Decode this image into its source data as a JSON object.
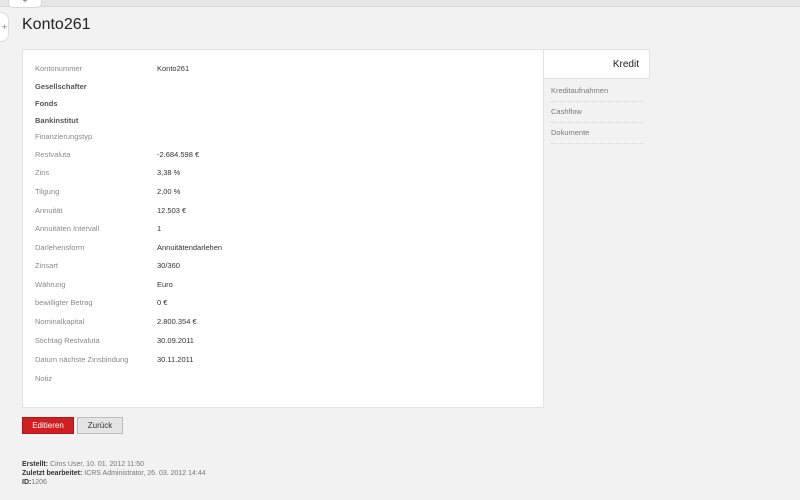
{
  "header": {
    "title": "Konto261",
    "top_tab_icon": "+",
    "side_toggle_icon": "+"
  },
  "details": [
    {
      "label": "Kontonummer",
      "value": "Konto261",
      "bold": false
    },
    {
      "label": "Gesellschafter",
      "value": "",
      "bold": true
    },
    {
      "label": "Fonds",
      "value": "",
      "bold": true
    },
    {
      "label": "Bankinstitut",
      "value": "",
      "bold": true
    },
    {
      "label": "Finanzierungstyp",
      "value": "",
      "bold": false
    },
    {
      "label": "Restvaluta",
      "value": "-2.684.598 €",
      "bold": false
    },
    {
      "label": "Zins",
      "value": "3,38 %",
      "bold": false
    },
    {
      "label": "Tilgung",
      "value": "2,00 %",
      "bold": false
    },
    {
      "label": "Annuität",
      "value": "12.503 €",
      "bold": false
    },
    {
      "label": "Annuitäten Intervall",
      "value": "1",
      "bold": false
    },
    {
      "label": "Darlehensform",
      "value": "Annuitätendarlehen",
      "bold": false
    },
    {
      "label": "Zinsart",
      "value": "30/360",
      "bold": false
    },
    {
      "label": "Währung",
      "value": "Euro",
      "bold": false
    },
    {
      "label": "bewilligter Betrag",
      "value": "0 €",
      "bold": false
    },
    {
      "label": "Nominalkapital",
      "value": "2.800.354 €",
      "bold": false
    },
    {
      "label": "Stichtag Restvaluta",
      "value": "30.09.2011",
      "bold": false
    },
    {
      "label": "Datum nächste Zinsbindung",
      "value": "30.11.2011",
      "bold": false
    },
    {
      "label": "Notiz",
      "value": "",
      "bold": false
    }
  ],
  "side_menu": {
    "active": "Kredit",
    "items": [
      "Kreditaufnahmen",
      "Cashflow",
      "Dokumente"
    ]
  },
  "buttons": {
    "edit": "Editieren",
    "back": "Zurück"
  },
  "footer": {
    "created_label": "Erstellt:",
    "created_value": "Cims User, 10. 01. 2012 11:50",
    "edited_label": "Zuletzt bearbeitet:",
    "edited_value": "ICRS Administrator, 26. 03. 2012 14:44",
    "id_label": "ID:",
    "id_value": "1206"
  }
}
